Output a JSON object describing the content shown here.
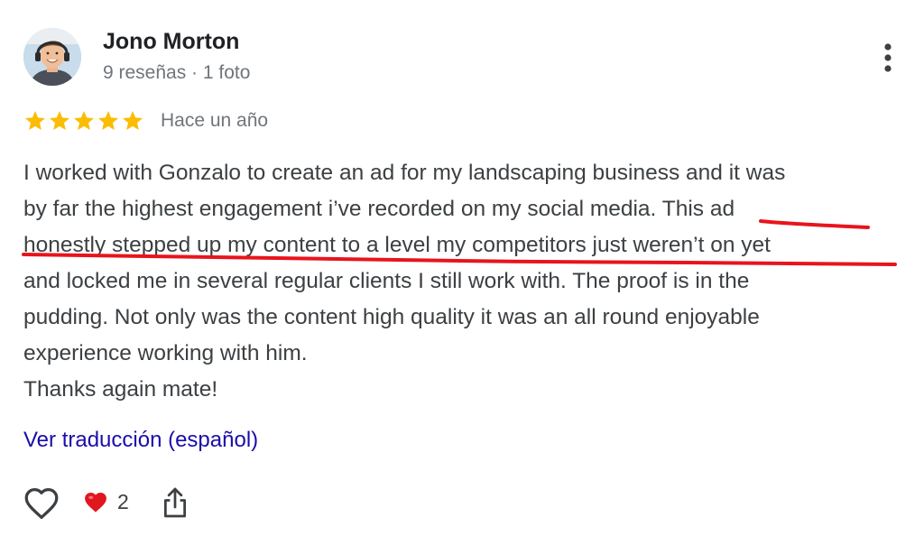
{
  "reviewer": {
    "name": "Jono Morton",
    "meta": "9 reseñas · 1 foto",
    "avatar_icon": "person-photo"
  },
  "rating": {
    "stars": 5,
    "max": 5,
    "date": "Hace un año",
    "star_color": "#fbbc04"
  },
  "review": {
    "lines": [
      "I worked with Gonzalo to create an ad for my landscaping business and it was",
      "by far the highest engagement i’ve recorded on my social media. This ad",
      "honestly stepped up my content to a level my competitors just weren’t on yet",
      "and locked me in several regular clients I still work with. The proof is in the",
      "pudding. Not only was the content high quality it was an all round enjoyable",
      "experience working with him.",
      "Thanks again mate!"
    ],
    "highlight_color": "#e8141c"
  },
  "translate_link": "Ver traducción (español)",
  "actions": {
    "like_icon": "heart-outline-icon",
    "reaction_icon": "red-heart-emoji",
    "reaction_count": "2",
    "share_icon": "share-icon"
  },
  "menu_icon": "more-vert-icon",
  "colors": {
    "name": "#202124",
    "meta": "#70757a",
    "body": "#3c4043",
    "link": "#1a0dab"
  }
}
